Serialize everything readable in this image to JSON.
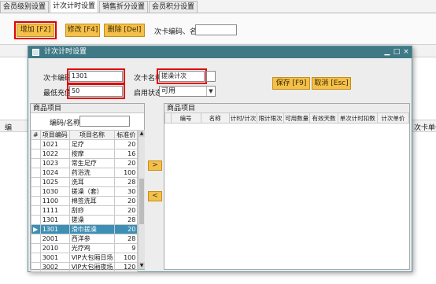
{
  "tabs": [
    "会员级别设置",
    "计次计时设置",
    "销售折分设置",
    "会员积分设置"
  ],
  "active_tab": 1,
  "toolbar": {
    "add_label": "增加 [F2]",
    "edit_label": "修改 [F4]",
    "delete_label": "删除 [Del]",
    "search_label": "次卡编码、名称:",
    "search_value": ""
  },
  "background": {
    "left_col": "编",
    "right_col": "次卡单价"
  },
  "dialog": {
    "title": "计次计时设置",
    "minimize": "▁",
    "maximize": "□",
    "close": "×",
    "code_label": "次卡编码:",
    "code_value": "1301",
    "name_label": "次卡名称:",
    "name_value": "搓澡计次",
    "min_top_label": "最低充值:",
    "min_top_value": "50",
    "enable_label": "启用状态:",
    "enable_value": "可用",
    "save_label": "保存 [F9]",
    "cancel_label": "取消 [Esc]",
    "left_panel": {
      "title": "商品项目",
      "search_label": "编码/名称:",
      "search_value": "",
      "headers": [
        "项目编码",
        "项目名称",
        "标准价"
      ],
      "selected_index": 9,
      "rows": [
        {
          "code": "1021",
          "name": "足疗",
          "price": "20"
        },
        {
          "code": "1022",
          "name": "按摩",
          "price": "16"
        },
        {
          "code": "1023",
          "name": "常生足疗",
          "price": "20"
        },
        {
          "code": "1024",
          "name": "药浴洗",
          "price": "100"
        },
        {
          "code": "1025",
          "name": "洗耳",
          "price": "28"
        },
        {
          "code": "1030",
          "name": "搓澡（套）",
          "price": "30"
        },
        {
          "code": "1100",
          "name": "棉签洗耳",
          "price": "20"
        },
        {
          "code": "1111",
          "name": "刮痧",
          "price": "20"
        },
        {
          "code": "1301",
          "name": "搓澡",
          "price": "28"
        },
        {
          "code": "1301",
          "name": "滑巾搓澡",
          "price": "20"
        },
        {
          "code": "2001",
          "name": "西洋参",
          "price": "28"
        },
        {
          "code": "2010",
          "name": "光疗鸡",
          "price": "9"
        },
        {
          "code": "3001",
          "name": "VIP大包厢日场",
          "price": "100"
        },
        {
          "code": "3002",
          "name": "VIP大包厢夜场",
          "price": "120"
        }
      ]
    },
    "right_panel": {
      "title": "商品项目",
      "headers": [
        "编号",
        "名称",
        "计时/计次",
        "限计限次",
        "可用数量",
        "有效天数",
        "单次计时扣数",
        "计次单价"
      ]
    },
    "move_right": ">",
    "move_left": "<"
  }
}
